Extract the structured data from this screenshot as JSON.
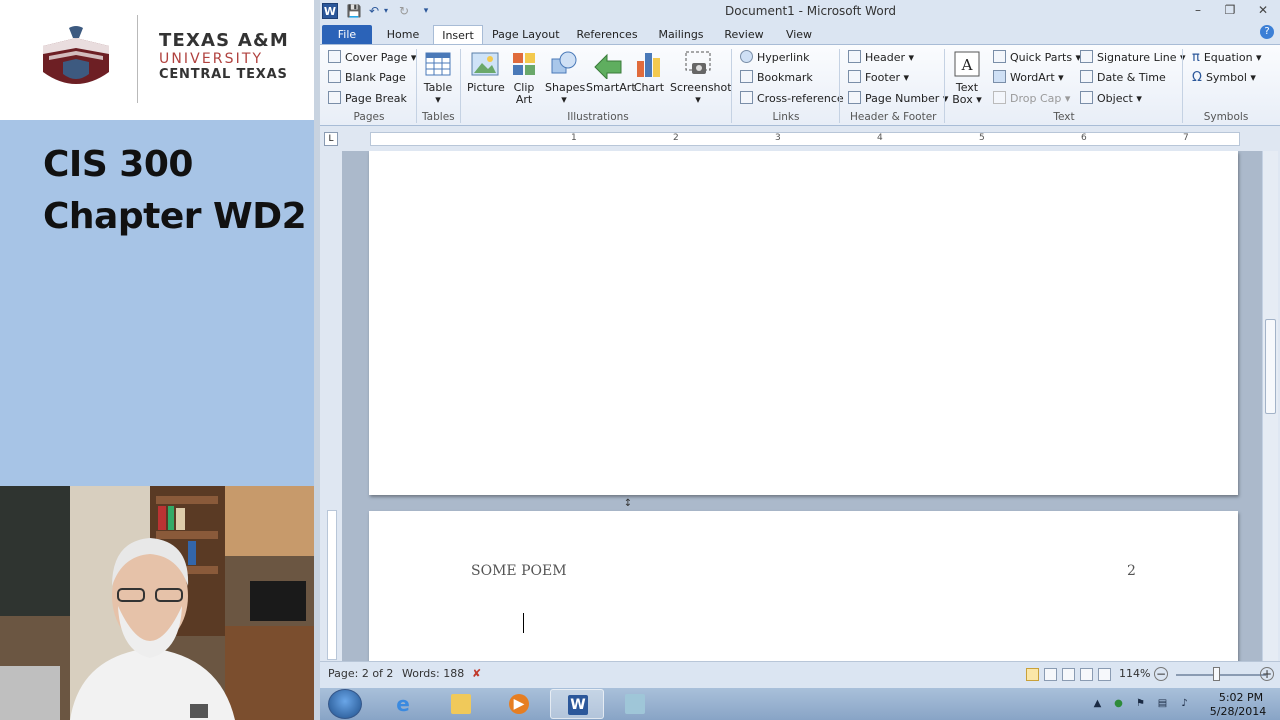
{
  "lecture": {
    "logo": {
      "line1": "TEXAS A&M",
      "line2": "UNIVERSITY",
      "line3": "CENTRAL TEXAS"
    },
    "course_code": "CIS 300",
    "chapter": "Chapter WD2"
  },
  "word": {
    "window_title": "Document1  -  Microsoft Word",
    "tabs": [
      {
        "label": "File"
      },
      {
        "label": "Home"
      },
      {
        "label": "Insert"
      },
      {
        "label": "Page Layout"
      },
      {
        "label": "References"
      },
      {
        "label": "Mailings"
      },
      {
        "label": "Review"
      },
      {
        "label": "View"
      }
    ],
    "active_tab": "Insert",
    "ribbon": {
      "pages": {
        "label": "Pages",
        "cover_page": "Cover Page",
        "blank_page": "Blank Page",
        "page_break": "Page Break"
      },
      "tables": {
        "label": "Tables",
        "table": "Table"
      },
      "illustrations": {
        "label": "Illustrations",
        "picture": "Picture",
        "clip_art_1": "Clip",
        "clip_art_2": "Art",
        "shapes": "Shapes",
        "smartart": "SmartArt",
        "chart": "Chart",
        "screenshot": "Screenshot"
      },
      "links": {
        "label": "Links",
        "hyperlink": "Hyperlink",
        "bookmark": "Bookmark",
        "cross_reference": "Cross-reference"
      },
      "header_footer": {
        "label": "Header & Footer",
        "header": "Header",
        "footer": "Footer",
        "page_number": "Page Number"
      },
      "text": {
        "label": "Text",
        "text_box_1": "Text",
        "text_box_2": "Box",
        "quick_parts": "Quick Parts",
        "wordart": "WordArt",
        "drop_cap": "Drop Cap",
        "signature_line": "Signature Line",
        "date_time": "Date & Time",
        "object": "Object"
      },
      "symbols": {
        "label": "Symbols",
        "equation": "Equation",
        "symbol": "Symbol"
      }
    },
    "ruler_numbers": [
      "1",
      "2",
      "3",
      "4",
      "5",
      "6",
      "7"
    ],
    "document": {
      "header_text": "SOME POEM",
      "page_number": "2"
    },
    "status": {
      "page": "Page: 2 of 2",
      "words": "Words: 188",
      "zoom": "114%"
    }
  },
  "taskbar": {
    "time": "5:02 PM",
    "date": "5/28/2014"
  },
  "colors": {
    "file_tab": "#2b63b8",
    "title_panel": "#a7c4e6",
    "logo_red": "#b0413e"
  }
}
